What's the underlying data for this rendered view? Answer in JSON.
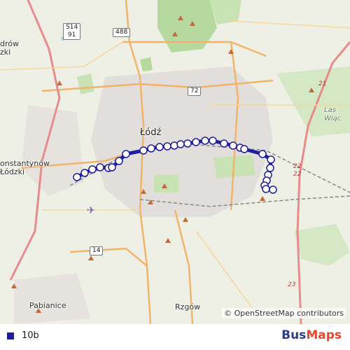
{
  "map": {
    "places": [
      {
        "id": "lodz",
        "text": "Łódź",
        "cls": "city"
      },
      {
        "id": "konstantynow",
        "text": "onstantynów\nŁódzki",
        "cls": ""
      },
      {
        "id": "zgierz-drow",
        "text": "drów\nzki",
        "cls": ""
      },
      {
        "id": "pabianice",
        "text": "Pabianice",
        "cls": ""
      },
      {
        "id": "rzgow",
        "text": "Rzgów",
        "cls": ""
      },
      {
        "id": "las-wiaca",
        "text": "Las Wiąc",
        "cls": "italic"
      }
    ],
    "shields": [
      {
        "id": "s14",
        "text": "S14\n91",
        "cls": ""
      },
      {
        "id": "r488",
        "text": "488",
        "cls": ""
      },
      {
        "id": "r72",
        "text": "72",
        "cls": ""
      },
      {
        "id": "r14",
        "text": "14",
        "cls": ""
      },
      {
        "id": "r21",
        "text": "21",
        "cls": "red"
      },
      {
        "id": "r22",
        "text": "22\n22",
        "cls": "red"
      },
      {
        "id": "r23",
        "text": "23",
        "cls": "red"
      }
    ],
    "attribution": "© OpenStreetMap contributors",
    "route_color": "#1f1f9e",
    "stop_fill": "#ffffff"
  },
  "legend": {
    "route_name": "10b",
    "swatch_color": "#1f1f9e",
    "brand_part1": "Bus",
    "brand_part2": "Maps"
  }
}
